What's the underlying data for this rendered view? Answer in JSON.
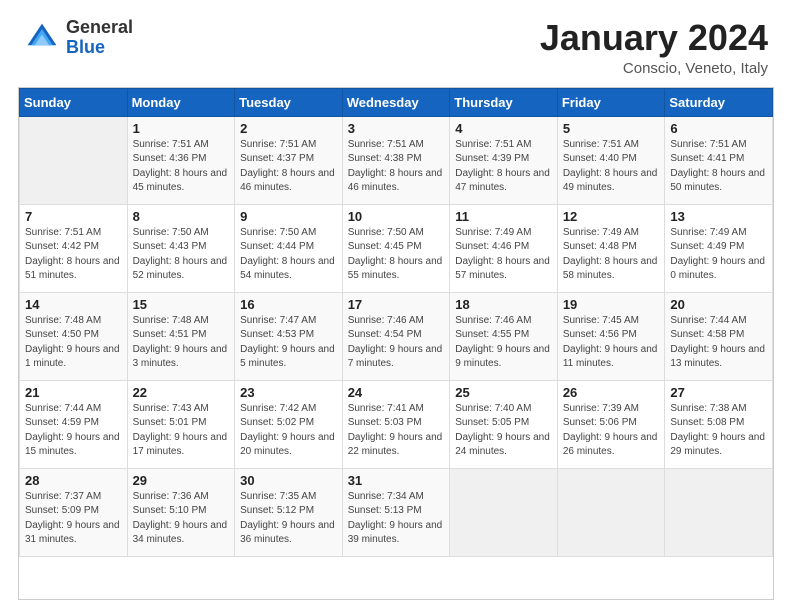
{
  "header": {
    "logo_general": "General",
    "logo_blue": "Blue",
    "month_title": "January 2024",
    "location": "Conscio, Veneto, Italy"
  },
  "weekdays": [
    "Sunday",
    "Monday",
    "Tuesday",
    "Wednesday",
    "Thursday",
    "Friday",
    "Saturday"
  ],
  "weeks": [
    [
      {
        "day": "",
        "sunrise": "",
        "sunset": "",
        "daylight": "",
        "empty": true
      },
      {
        "day": "1",
        "sunrise": "Sunrise: 7:51 AM",
        "sunset": "Sunset: 4:36 PM",
        "daylight": "Daylight: 8 hours and 45 minutes."
      },
      {
        "day": "2",
        "sunrise": "Sunrise: 7:51 AM",
        "sunset": "Sunset: 4:37 PM",
        "daylight": "Daylight: 8 hours and 46 minutes."
      },
      {
        "day": "3",
        "sunrise": "Sunrise: 7:51 AM",
        "sunset": "Sunset: 4:38 PM",
        "daylight": "Daylight: 8 hours and 46 minutes."
      },
      {
        "day": "4",
        "sunrise": "Sunrise: 7:51 AM",
        "sunset": "Sunset: 4:39 PM",
        "daylight": "Daylight: 8 hours and 47 minutes."
      },
      {
        "day": "5",
        "sunrise": "Sunrise: 7:51 AM",
        "sunset": "Sunset: 4:40 PM",
        "daylight": "Daylight: 8 hours and 49 minutes."
      },
      {
        "day": "6",
        "sunrise": "Sunrise: 7:51 AM",
        "sunset": "Sunset: 4:41 PM",
        "daylight": "Daylight: 8 hours and 50 minutes."
      }
    ],
    [
      {
        "day": "7",
        "sunrise": "Sunrise: 7:51 AM",
        "sunset": "Sunset: 4:42 PM",
        "daylight": "Daylight: 8 hours and 51 minutes."
      },
      {
        "day": "8",
        "sunrise": "Sunrise: 7:50 AM",
        "sunset": "Sunset: 4:43 PM",
        "daylight": "Daylight: 8 hours and 52 minutes."
      },
      {
        "day": "9",
        "sunrise": "Sunrise: 7:50 AM",
        "sunset": "Sunset: 4:44 PM",
        "daylight": "Daylight: 8 hours and 54 minutes."
      },
      {
        "day": "10",
        "sunrise": "Sunrise: 7:50 AM",
        "sunset": "Sunset: 4:45 PM",
        "daylight": "Daylight: 8 hours and 55 minutes."
      },
      {
        "day": "11",
        "sunrise": "Sunrise: 7:49 AM",
        "sunset": "Sunset: 4:46 PM",
        "daylight": "Daylight: 8 hours and 57 minutes."
      },
      {
        "day": "12",
        "sunrise": "Sunrise: 7:49 AM",
        "sunset": "Sunset: 4:48 PM",
        "daylight": "Daylight: 8 hours and 58 minutes."
      },
      {
        "day": "13",
        "sunrise": "Sunrise: 7:49 AM",
        "sunset": "Sunset: 4:49 PM",
        "daylight": "Daylight: 9 hours and 0 minutes."
      }
    ],
    [
      {
        "day": "14",
        "sunrise": "Sunrise: 7:48 AM",
        "sunset": "Sunset: 4:50 PM",
        "daylight": "Daylight: 9 hours and 1 minute."
      },
      {
        "day": "15",
        "sunrise": "Sunrise: 7:48 AM",
        "sunset": "Sunset: 4:51 PM",
        "daylight": "Daylight: 9 hours and 3 minutes."
      },
      {
        "day": "16",
        "sunrise": "Sunrise: 7:47 AM",
        "sunset": "Sunset: 4:53 PM",
        "daylight": "Daylight: 9 hours and 5 minutes."
      },
      {
        "day": "17",
        "sunrise": "Sunrise: 7:46 AM",
        "sunset": "Sunset: 4:54 PM",
        "daylight": "Daylight: 9 hours and 7 minutes."
      },
      {
        "day": "18",
        "sunrise": "Sunrise: 7:46 AM",
        "sunset": "Sunset: 4:55 PM",
        "daylight": "Daylight: 9 hours and 9 minutes."
      },
      {
        "day": "19",
        "sunrise": "Sunrise: 7:45 AM",
        "sunset": "Sunset: 4:56 PM",
        "daylight": "Daylight: 9 hours and 11 minutes."
      },
      {
        "day": "20",
        "sunrise": "Sunrise: 7:44 AM",
        "sunset": "Sunset: 4:58 PM",
        "daylight": "Daylight: 9 hours and 13 minutes."
      }
    ],
    [
      {
        "day": "21",
        "sunrise": "Sunrise: 7:44 AM",
        "sunset": "Sunset: 4:59 PM",
        "daylight": "Daylight: 9 hours and 15 minutes."
      },
      {
        "day": "22",
        "sunrise": "Sunrise: 7:43 AM",
        "sunset": "Sunset: 5:01 PM",
        "daylight": "Daylight: 9 hours and 17 minutes."
      },
      {
        "day": "23",
        "sunrise": "Sunrise: 7:42 AM",
        "sunset": "Sunset: 5:02 PM",
        "daylight": "Daylight: 9 hours and 20 minutes."
      },
      {
        "day": "24",
        "sunrise": "Sunrise: 7:41 AM",
        "sunset": "Sunset: 5:03 PM",
        "daylight": "Daylight: 9 hours and 22 minutes."
      },
      {
        "day": "25",
        "sunrise": "Sunrise: 7:40 AM",
        "sunset": "Sunset: 5:05 PM",
        "daylight": "Daylight: 9 hours and 24 minutes."
      },
      {
        "day": "26",
        "sunrise": "Sunrise: 7:39 AM",
        "sunset": "Sunset: 5:06 PM",
        "daylight": "Daylight: 9 hours and 26 minutes."
      },
      {
        "day": "27",
        "sunrise": "Sunrise: 7:38 AM",
        "sunset": "Sunset: 5:08 PM",
        "daylight": "Daylight: 9 hours and 29 minutes."
      }
    ],
    [
      {
        "day": "28",
        "sunrise": "Sunrise: 7:37 AM",
        "sunset": "Sunset: 5:09 PM",
        "daylight": "Daylight: 9 hours and 31 minutes."
      },
      {
        "day": "29",
        "sunrise": "Sunrise: 7:36 AM",
        "sunset": "Sunset: 5:10 PM",
        "daylight": "Daylight: 9 hours and 34 minutes."
      },
      {
        "day": "30",
        "sunrise": "Sunrise: 7:35 AM",
        "sunset": "Sunset: 5:12 PM",
        "daylight": "Daylight: 9 hours and 36 minutes."
      },
      {
        "day": "31",
        "sunrise": "Sunrise: 7:34 AM",
        "sunset": "Sunset: 5:13 PM",
        "daylight": "Daylight: 9 hours and 39 minutes."
      },
      {
        "day": "",
        "sunrise": "",
        "sunset": "",
        "daylight": "",
        "empty": true
      },
      {
        "day": "",
        "sunrise": "",
        "sunset": "",
        "daylight": "",
        "empty": true
      },
      {
        "day": "",
        "sunrise": "",
        "sunset": "",
        "daylight": "",
        "empty": true
      }
    ]
  ]
}
